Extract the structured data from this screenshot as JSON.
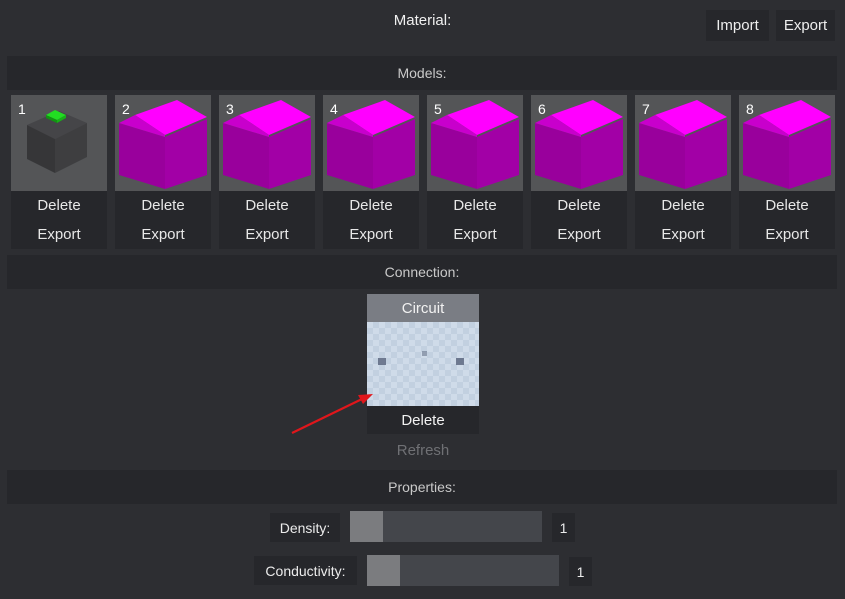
{
  "header": {
    "title": "Material:",
    "import_label": "Import",
    "export_label": "Export"
  },
  "models_section": {
    "title": "Models:",
    "items": [
      {
        "number": "1",
        "kind": "gray-cube",
        "delete_label": "Delete",
        "export_label": "Export"
      },
      {
        "number": "2",
        "kind": "magenta-cube",
        "delete_label": "Delete",
        "export_label": "Export"
      },
      {
        "number": "3",
        "kind": "magenta-cube",
        "delete_label": "Delete",
        "export_label": "Export"
      },
      {
        "number": "4",
        "kind": "magenta-cube",
        "delete_label": "Delete",
        "export_label": "Export"
      },
      {
        "number": "5",
        "kind": "magenta-cube",
        "delete_label": "Delete",
        "export_label": "Export"
      },
      {
        "number": "6",
        "kind": "magenta-cube",
        "delete_label": "Delete",
        "export_label": "Export"
      },
      {
        "number": "7",
        "kind": "magenta-cube",
        "delete_label": "Delete",
        "export_label": "Export"
      },
      {
        "number": "8",
        "kind": "magenta-cube",
        "delete_label": "Delete",
        "export_label": "Export"
      }
    ]
  },
  "connection_section": {
    "title": "Connection:",
    "card_title": "Circuit",
    "delete_label": "Delete",
    "refresh_label": "Refresh"
  },
  "properties_section": {
    "title": "Properties:",
    "density": {
      "label": "Density:",
      "value": "1",
      "fraction": 0.17
    },
    "conductivity": {
      "label": "Conductivity:",
      "value": "1",
      "fraction": 0.17
    }
  },
  "colors": {
    "accent_magenta": "#ff00ff",
    "cube_gray": "#3e3e40",
    "indicator_green": "#22dd22",
    "annotation_arrow": "#e0161b"
  }
}
